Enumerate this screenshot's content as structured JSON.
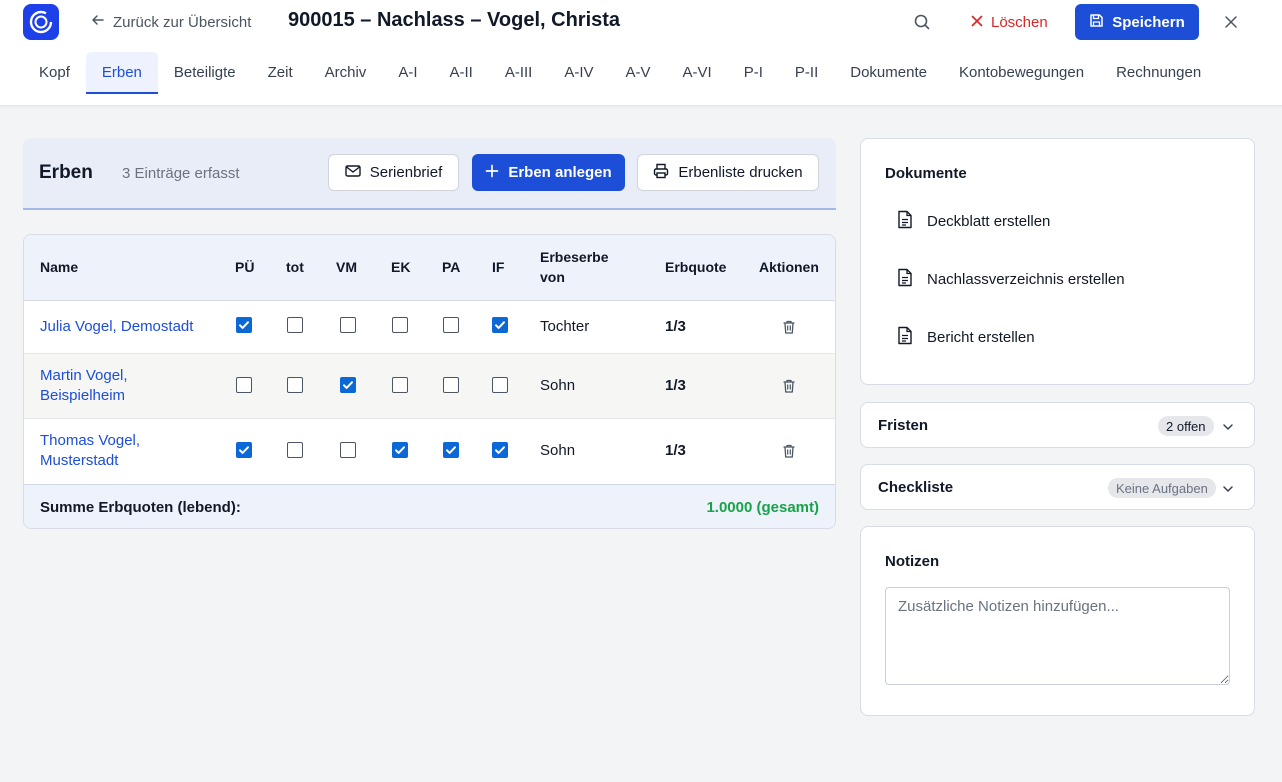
{
  "header": {
    "back_label": "Zurück zur Übersicht",
    "title": "900015 – Nachlass – Vogel, Christa",
    "delete_label": "Löschen",
    "save_label": "Speichern",
    "icons": [
      "app-logo-icon",
      "arrow-left-icon",
      "search-icon",
      "x-icon",
      "floppy-disk-icon",
      "close-icon"
    ]
  },
  "tabs": [
    {
      "label": "Kopf"
    },
    {
      "label": "Erben",
      "active": true
    },
    {
      "label": "Beteiligte"
    },
    {
      "label": "Zeit"
    },
    {
      "label": "Archiv"
    },
    {
      "label": "A-I"
    },
    {
      "label": "A-II"
    },
    {
      "label": "A-III"
    },
    {
      "label": "A-IV"
    },
    {
      "label": "A-V"
    },
    {
      "label": "A-VI"
    },
    {
      "label": "P-I"
    },
    {
      "label": "P-II"
    },
    {
      "label": "Dokumente"
    },
    {
      "label": "Kontobewegungen"
    },
    {
      "label": "Rechnungen"
    }
  ],
  "heirs_section": {
    "title": "Erben",
    "count_label": "3 Einträge erfasst",
    "serial_letter_label": "Serienbrief",
    "add_label": "Erben anlegen",
    "print_label": "Erbenliste drucken"
  },
  "table": {
    "columns": {
      "name": "Name",
      "pu": "PÜ",
      "tot": "tot",
      "vm": "VM",
      "ek": "EK",
      "pa": "PA",
      "if": "IF",
      "erbeserbe_1": "Erbeserbe",
      "erbeserbe_2": "von",
      "erbquote": "Erbquote",
      "aktionen": "Aktionen"
    },
    "rows": [
      {
        "name": "Julia Vogel, Demostadt",
        "pu": true,
        "tot": false,
        "vm": false,
        "ek": false,
        "pa": false,
        "if": true,
        "relation": "Tochter",
        "quote": "1/3"
      },
      {
        "name": "Martin Vogel, Beispielheim",
        "pu": false,
        "tot": false,
        "vm": true,
        "ek": false,
        "pa": false,
        "if": false,
        "relation": "Sohn",
        "quote": "1/3"
      },
      {
        "name": "Thomas Vogel, Musterstadt",
        "pu": true,
        "tot": false,
        "vm": false,
        "ek": true,
        "pa": true,
        "if": true,
        "relation": "Sohn",
        "quote": "1/3"
      }
    ],
    "footer_label": "Summe Erbquoten (lebend):",
    "footer_value": "1.0000 (gesamt)"
  },
  "documents": {
    "title": "Dokumente",
    "items": [
      "Deckblatt erstellen",
      "Nachlassverzeichnis erstellen",
      "Bericht erstellen"
    ]
  },
  "fristen": {
    "title": "Fristen",
    "badge": "2 offen"
  },
  "checkliste": {
    "title": "Checkliste",
    "badge": "Keine Aufgaben"
  },
  "notes": {
    "title": "Notizen",
    "placeholder": "Zusätzliche Notizen hinzufügen..."
  },
  "colors": {
    "accent": "#1d4ed8",
    "danger": "#dc2626",
    "success": "#16a34a",
    "checkbox": "#0b68d6"
  }
}
